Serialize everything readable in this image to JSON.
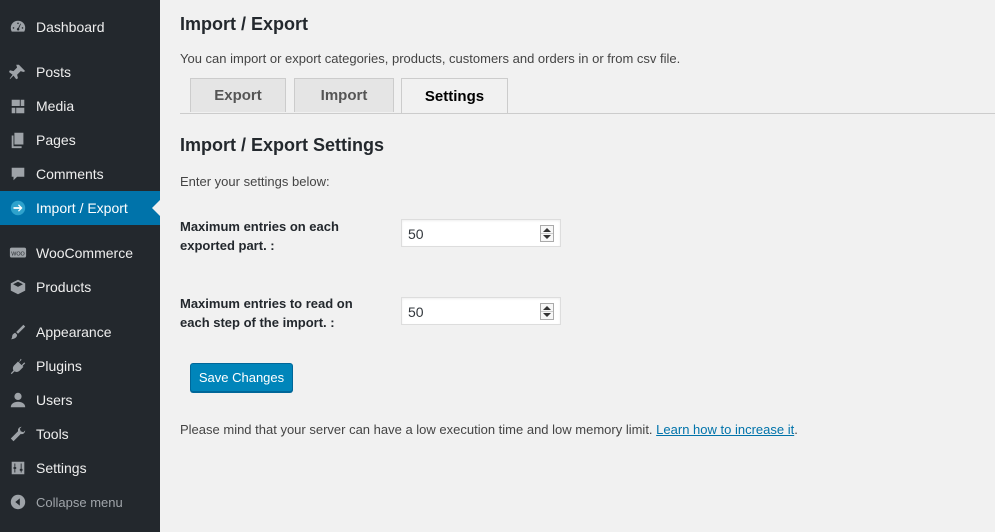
{
  "sidebar": {
    "items": [
      {
        "label": "Dashboard",
        "icon": "dashboard-icon"
      },
      {
        "label": "Posts",
        "icon": "pin-icon"
      },
      {
        "label": "Media",
        "icon": "media-icon"
      },
      {
        "label": "Pages",
        "icon": "pages-icon"
      },
      {
        "label": "Comments",
        "icon": "comment-icon"
      },
      {
        "label": "Import / Export",
        "icon": "import-export-icon",
        "active": true
      },
      {
        "label": "WooCommerce",
        "icon": "woocommerce-icon"
      },
      {
        "label": "Products",
        "icon": "box-icon"
      },
      {
        "label": "Appearance",
        "icon": "brush-icon"
      },
      {
        "label": "Plugins",
        "icon": "plug-icon"
      },
      {
        "label": "Users",
        "icon": "user-icon"
      },
      {
        "label": "Tools",
        "icon": "wrench-icon"
      },
      {
        "label": "Settings",
        "icon": "sliders-icon"
      }
    ],
    "collapse_label": "Collapse menu"
  },
  "main": {
    "title": "Import / Export",
    "intro": "You can import or export categories, products, customers and orders in or from csv file.",
    "tabs": [
      {
        "label": "Export"
      },
      {
        "label": "Import"
      },
      {
        "label": "Settings",
        "active": true
      }
    ],
    "section_title": "Import / Export Settings",
    "subtext": "Enter your settings below:",
    "fields": [
      {
        "label": "Maximum entries on each exported part. :",
        "value": "50"
      },
      {
        "label": "Maximum entries to read on each step of the import. :",
        "value": "50"
      }
    ],
    "save_label": "Save Changes",
    "notice_text": "Please mind that your server can have a low execution time and low memory limit.",
    "notice_link": "Learn how to increase it",
    "notice_end": "."
  },
  "colors": {
    "sidebar_bg": "#23282d",
    "active_bg": "#0073aa",
    "primary_button": "#0085ba",
    "link": "#0073aa",
    "page_bg": "#f1f1f1"
  }
}
